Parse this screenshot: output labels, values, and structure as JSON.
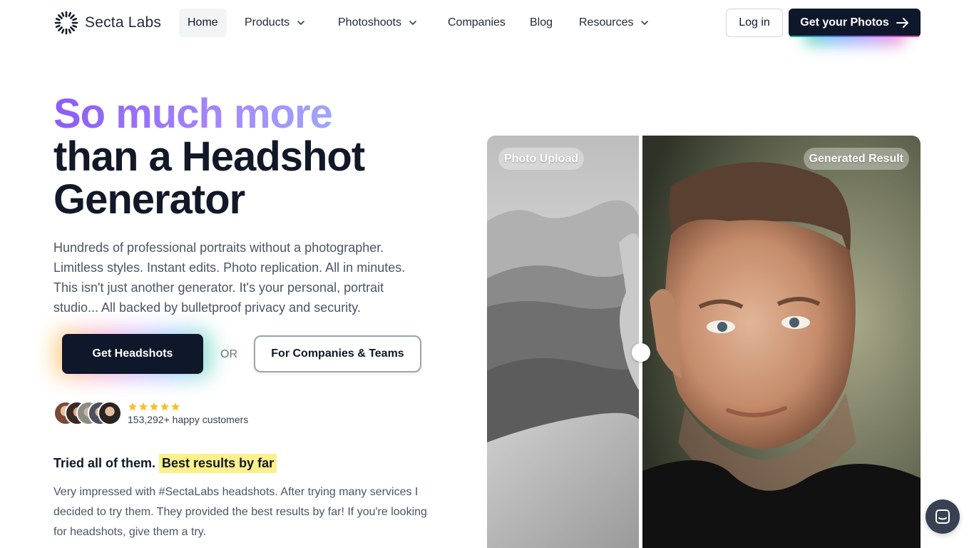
{
  "brand": {
    "name": "Secta Labs"
  },
  "nav": {
    "items": [
      {
        "label": "Home",
        "active": true,
        "dropdown": false
      },
      {
        "label": "Products",
        "dropdown": true
      },
      {
        "label": "Photoshoots",
        "dropdown": true
      },
      {
        "label": "Companies",
        "dropdown": false
      },
      {
        "label": "Blog",
        "dropdown": false
      },
      {
        "label": "Resources",
        "dropdown": true
      }
    ],
    "login_label": "Log in",
    "cta_label": "Get your Photos"
  },
  "hero": {
    "title_gradient": "So much more",
    "title_line2": "than a Headshot",
    "title_line3": "Generator",
    "description": "Hundreds of professional portraits without a photographer. Limitless styles. Instant edits. Photo replication. All in minutes. This isn't just another generator. It's your personal, portrait studio... All backed by bulletproof privacy and security.",
    "primary_button": "Get Headshots",
    "or_text": "OR",
    "secondary_button": "For Companies & Teams"
  },
  "social_proof": {
    "rating": 5,
    "customers_text": "153,292+ happy customers"
  },
  "testimonial": {
    "title": "Tried all of them.",
    "highlight": "Best results by far",
    "quote": "Very impressed with #SectaLabs headshots. After trying many services I decided to try them. They provided the best results by far! If you're looking for headshots, give them a try."
  },
  "compare": {
    "left_label": "Photo Upload",
    "right_label": "Generated Result",
    "slider_position": 0.35
  },
  "colors": {
    "accent_dark": "#0f172a",
    "gradient_start": "#8b5cf6",
    "gradient_end": "#93c5fd",
    "highlight": "#fef08a",
    "star": "#fbbf24"
  },
  "icons": [
    "logo-burst-icon",
    "chevron-down-icon",
    "arrow-right-icon",
    "star-icon",
    "chat-icon"
  ]
}
